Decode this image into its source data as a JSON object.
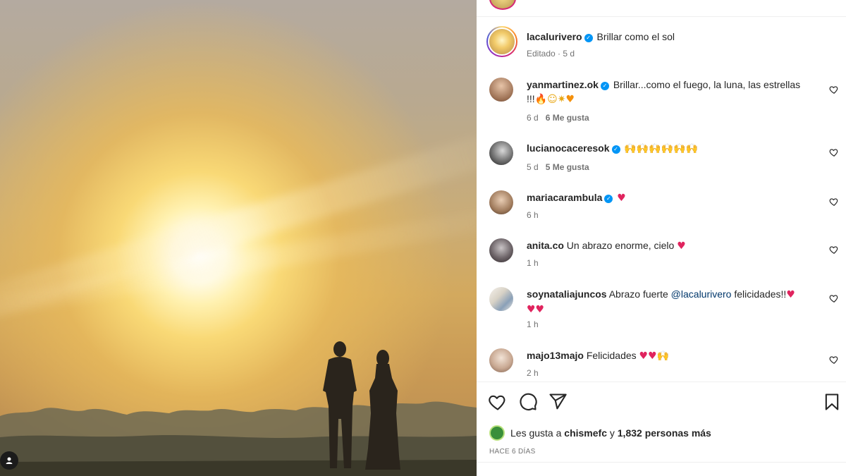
{
  "post": {
    "author": "lacalurivero",
    "caption": "Brillar como el sol",
    "edited_label": "Editado",
    "age": "5 d"
  },
  "comments": [
    {
      "username": "yanmartinez.ok",
      "verified": true,
      "text_line1": "Brillar...como el fuego, la luna, las estrellas",
      "text_line2_prefix": "!!!",
      "emojis": [
        "fire",
        "slightly-smiling-face",
        "sparkles-sun",
        "orange-heart"
      ],
      "age": "6 d",
      "likes": "6 Me gusta"
    },
    {
      "username": "lucianocaceresok",
      "verified": true,
      "emojis": [
        "raised-hands",
        "raised-hands",
        "raised-hands",
        "raised-hands",
        "raised-hands",
        "raised-hands"
      ],
      "age": "5 d",
      "likes": "5 Me gusta"
    },
    {
      "username": "mariacarambula",
      "verified": true,
      "emojis": [
        "red-heart"
      ],
      "age": "6 h"
    },
    {
      "username": "anita.co",
      "text": "Un abrazo enorme, cielo",
      "emojis": [
        "red-heart"
      ],
      "age": "1 h"
    },
    {
      "username": "soynataliajuncos",
      "text_before": "Abrazo fuerte",
      "mention": "@lacalurivero",
      "text_after": "felicidades!!",
      "emojis": [
        "red-heart",
        "red-heart",
        "red-heart"
      ],
      "age": "1 h"
    },
    {
      "username": "majo13majo",
      "text": "Felicidades",
      "emojis": [
        "red-heart",
        "red-heart",
        "raised-hands"
      ],
      "age": "2 h"
    }
  ],
  "likes_bar": {
    "prefix": "Les gusta a",
    "user": "chismefc",
    "connector": "y",
    "count": "1,832 personas más"
  },
  "timestamp": "HACE 6 DÍAS",
  "icons": {
    "like": "heart-outline-icon",
    "comment": "comment-bubble-icon",
    "share": "paper-plane-icon",
    "save": "bookmark-icon"
  },
  "colors": {
    "verified": "#0095f6",
    "mention": "#00376b",
    "heart": "#e0245e",
    "meta": "#737373"
  }
}
